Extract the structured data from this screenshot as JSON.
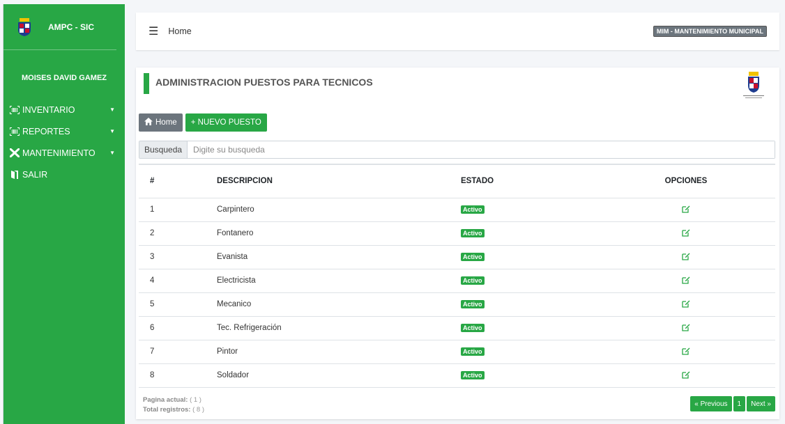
{
  "app": {
    "brand": "AMPC - SIC",
    "user": "MOISES DAVID GAMEZ"
  },
  "sidebar": {
    "items": [
      {
        "label": "INVENTARIO",
        "icon": "barcode-icon",
        "caret": true
      },
      {
        "label": "REPORTES",
        "icon": "barcode-icon",
        "caret": true
      },
      {
        "label": "MANTENIMIENTO",
        "icon": "tools-icon",
        "caret": true
      },
      {
        "label": "SALIR",
        "icon": "door-exit-icon",
        "caret": false
      }
    ]
  },
  "topbar": {
    "breadcrumb": "Home",
    "badge": "MIM - MANTENIMIENTO MUNICIPAL"
  },
  "card": {
    "title": "ADMINISTRACION PUESTOS PARA TECNICOS",
    "home_button": "Home",
    "new_button": "+ NUEVO PUESTO",
    "search_label": "Busqueda",
    "search_placeholder": "Digite su busqueda"
  },
  "table": {
    "headers": [
      "#",
      "DESCRIPCION",
      "ESTADO",
      "OPCIONES"
    ],
    "rows": [
      {
        "num": "1",
        "desc": "Carpintero",
        "estado": "Activo"
      },
      {
        "num": "2",
        "desc": "Fontanero",
        "estado": "Activo"
      },
      {
        "num": "3",
        "desc": "Evanista",
        "estado": "Activo"
      },
      {
        "num": "4",
        "desc": "Electricista",
        "estado": "Activo"
      },
      {
        "num": "5",
        "desc": "Mecanico",
        "estado": "Activo"
      },
      {
        "num": "6",
        "desc": "Tec. Refrigeración",
        "estado": "Activo"
      },
      {
        "num": "7",
        "desc": "Pintor",
        "estado": "Activo"
      },
      {
        "num": "8",
        "desc": "Soldador",
        "estado": "Activo"
      }
    ]
  },
  "footer": {
    "page_label": "Pagina actual:",
    "page_value": "( 1 )",
    "total_label": "Total registros:",
    "total_value": "( 8 )"
  },
  "pagination": {
    "previous": "« Previous",
    "current": "1",
    "next": "Next »"
  },
  "colors": {
    "accent": "#28a745",
    "grey": "#6c757d"
  }
}
